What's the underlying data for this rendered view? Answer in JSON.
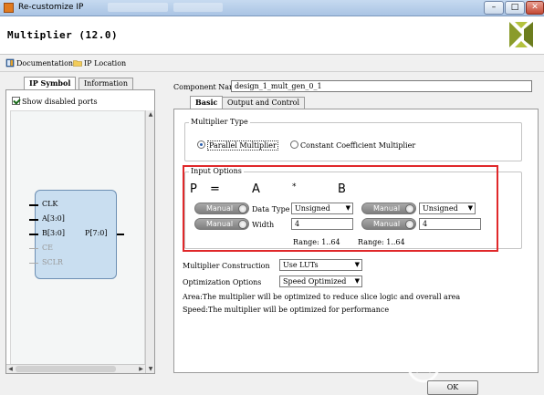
{
  "window": {
    "title": "Re-customize IP",
    "close_glyph": "✕",
    "minimize_glyph": "–",
    "maximize_glyph": "□"
  },
  "header": {
    "title": "Multiplier (12.0)",
    "logo": "xilinx-logo",
    "logo_color": "#8a9b2b"
  },
  "links": {
    "documentation": "Documentation",
    "ip_location": "IP Location"
  },
  "left_panel": {
    "tabs": [
      "IP Symbol",
      "Information"
    ],
    "show_disabled_ports_label": "Show disabled ports",
    "show_disabled_ports_checked": true,
    "symbol": {
      "inputs": [
        {
          "name": "CLK",
          "enabled": true
        },
        {
          "name": "A[3:0]",
          "enabled": true
        },
        {
          "name": "B[3:0]",
          "enabled": true
        },
        {
          "name": "CE",
          "enabled": false
        },
        {
          "name": "SCLR",
          "enabled": false
        }
      ],
      "output": "P[7:0]",
      "block_color": "#c9def0"
    }
  },
  "component": {
    "label": "Component Name",
    "value": "design_1_mult_gen_0_1"
  },
  "tabs": [
    "Basic",
    "Output and Control"
  ],
  "multiplier_type": {
    "group_label": "Multiplier Type",
    "options": [
      "Parallel Multiplier",
      "Constant Coefficient Multiplier"
    ],
    "selected": "Parallel Multiplier"
  },
  "input_options": {
    "group_label": "Input Options",
    "equation": {
      "p": "P",
      "eq": "=",
      "a": "A",
      "op": "*",
      "b": "B"
    },
    "a": {
      "mode": "Manual",
      "data_type_label": "Data Type",
      "data_type": "Unsigned",
      "width_label": "Width",
      "width": "4",
      "range": "Range: 1..64"
    },
    "b": {
      "mode": "Manual",
      "data_type": "Unsigned",
      "width": "4",
      "range": "Range: 1..64"
    },
    "highlight_color": "#e0282a"
  },
  "construction": {
    "label": "Multiplier Construction",
    "value": "Use LUTs"
  },
  "optimization": {
    "label": "Optimization Options",
    "value": "Speed Optimized"
  },
  "notes": [
    "Area:The multiplier will be optimized to reduce slice logic and overall area",
    "Speed:The multiplier will be optimized for performance"
  ],
  "buttons": {
    "ok": "OK"
  },
  "watermark": "电子发烧友"
}
